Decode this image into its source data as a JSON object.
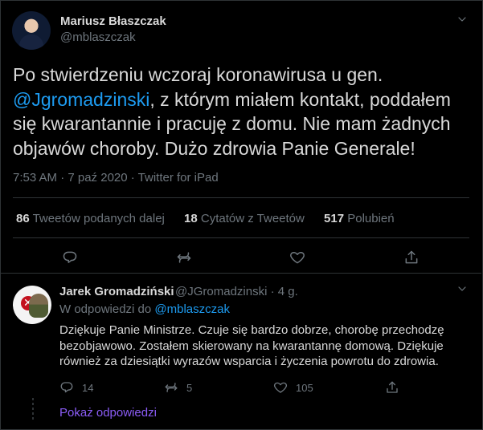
{
  "tweet": {
    "author_name": "Mariusz Błaszczak",
    "author_handle": "@mblaszczak",
    "text_line1": "Po stwierdzeniu wczoraj koronawirusa u gen.",
    "mention": "@Jgromadzinski",
    "text_line2_rest": ", z którym miałem kontakt, poddałem",
    "text_line3": "się kwarantannie i pracuję z domu. Nie mam żadnych",
    "text_line4": "objawów choroby. Dużo zdrowia Panie Generale!",
    "meta": "7:53 AM · 7 paź 2020 · Twitter for iPad",
    "stats": {
      "retweets_num": "86",
      "retweets_label": "Tweetów podanych dalej",
      "quotes_num": "18",
      "quotes_label": "Cytatów z Tweetów",
      "likes_num": "517",
      "likes_label": "Polubień"
    },
    "icons": {
      "more": "chevron-down-icon",
      "reply": "reply-icon",
      "retweet": "retweet-icon",
      "like": "heart-icon",
      "share": "share-icon"
    }
  },
  "reply": {
    "author_name": "Jarek Gromadziński",
    "author_handle_time": "@JGromadzinski · 4 g.",
    "in_reply_prefix": "W odpowiedzi do",
    "in_reply_mention": "@mblaszczak",
    "text_line1": "Dziękuje Panie Ministrze. Czuje się bardzo dobrze, chorobę przechodzę",
    "text_line2": "bezobjawowo. Zostałem skierowany na kwarantannę domową. Dziękuje",
    "text_line3": "również za dziesiątki wyrazów wsparcia i życzenia powrotu do zdrowia.",
    "counts": {
      "replies": "14",
      "retweets": "5",
      "likes": "105"
    },
    "show_replies": "Pokaż odpowiedzi"
  },
  "colors": {
    "background": "#000000",
    "text": "#d9d9d9",
    "muted": "#6e767d",
    "link": "#1d9bf0",
    "divider": "#2f3336",
    "show_replies": "#8b5cf6"
  }
}
